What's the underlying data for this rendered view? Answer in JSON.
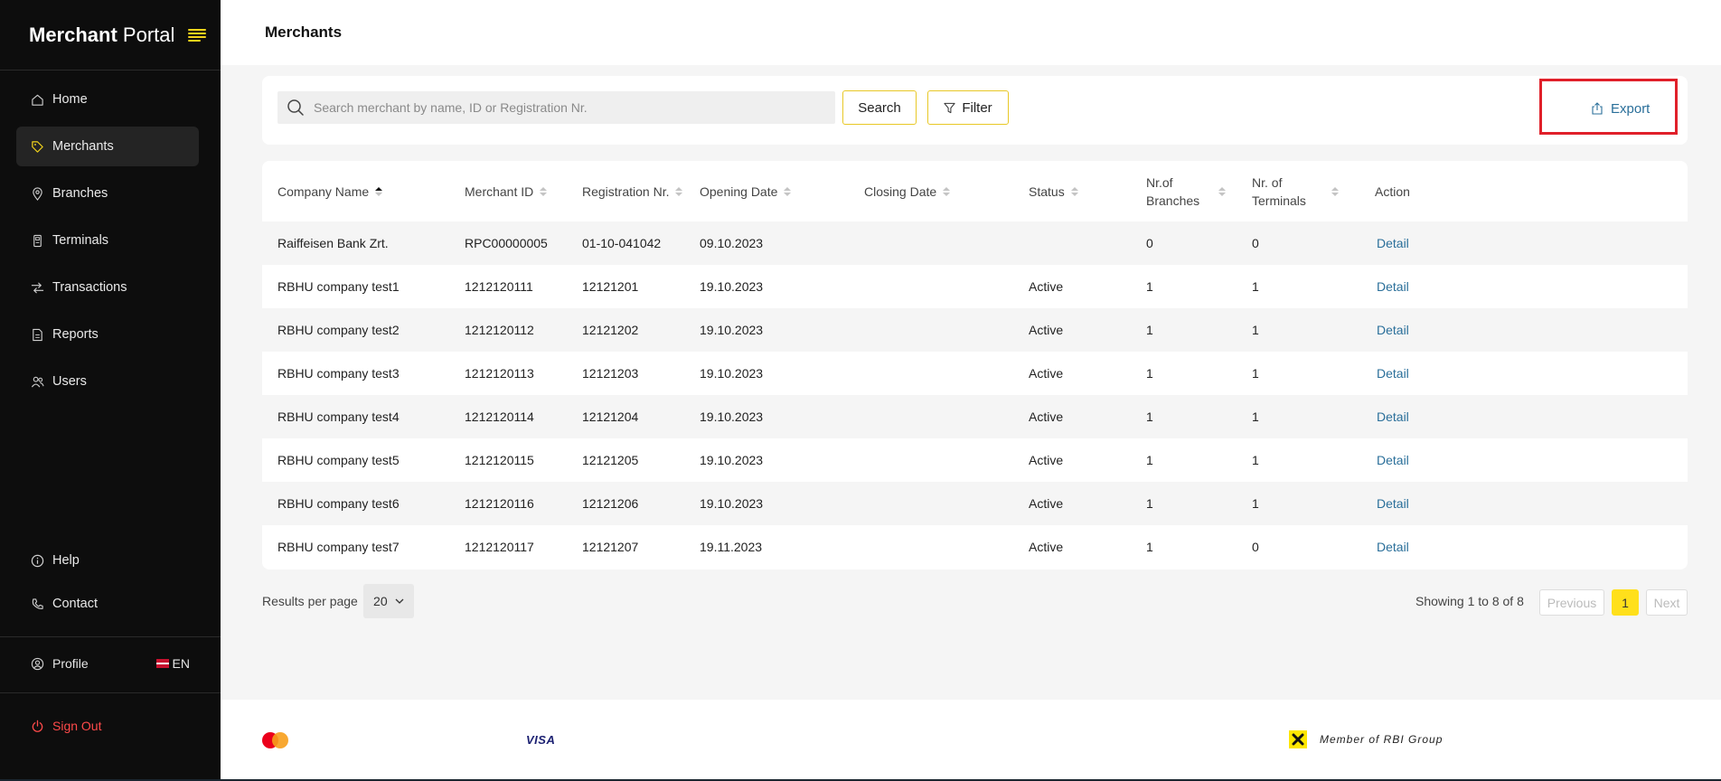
{
  "app": {
    "brand_bold": "Merchant",
    "brand_regular": "Portal"
  },
  "sidebar": {
    "items": [
      {
        "label": "Home",
        "icon": "home-icon"
      },
      {
        "label": "Merchants",
        "icon": "tag-icon",
        "active": true
      },
      {
        "label": "Branches",
        "icon": "location-pin-icon"
      },
      {
        "label": "Terminals",
        "icon": "terminal-icon"
      },
      {
        "label": "Transactions",
        "icon": "transfer-arrows-icon"
      },
      {
        "label": "Reports",
        "icon": "report-icon"
      },
      {
        "label": "Users",
        "icon": "users-icon"
      }
    ],
    "help_label": "Help",
    "contact_label": "Contact",
    "profile_label": "Profile",
    "language": "EN",
    "signout_label": "Sign Out"
  },
  "header": {
    "title": "Merchants"
  },
  "search": {
    "placeholder": "Search merchant by name, ID or Registration Nr.",
    "value": "",
    "search_label": "Search",
    "filter_label": "Filter",
    "export_label": "Export"
  },
  "table": {
    "columns": [
      "Company Name",
      "Merchant ID",
      "Registration Nr.",
      "Opening Date",
      "Closing Date",
      "Status",
      "Nr.of Branches",
      "Nr. of Terminals",
      "Action"
    ],
    "rows": [
      {
        "company": "Raiffeisen Bank Zrt.",
        "merchant_id": "RPC00000005",
        "registration": "01-10-041042",
        "opening": "09.10.2023",
        "closing": "",
        "status": "",
        "branches": "0",
        "terminals": "0",
        "action": "Detail"
      },
      {
        "company": "RBHU company test1",
        "merchant_id": "1212120111",
        "registration": "12121201",
        "opening": "19.10.2023",
        "closing": "",
        "status": "Active",
        "branches": "1",
        "terminals": "1",
        "action": "Detail"
      },
      {
        "company": "RBHU company test2",
        "merchant_id": "1212120112",
        "registration": "12121202",
        "opening": "19.10.2023",
        "closing": "",
        "status": "Active",
        "branches": "1",
        "terminals": "1",
        "action": "Detail"
      },
      {
        "company": "RBHU company test3",
        "merchant_id": "1212120113",
        "registration": "12121203",
        "opening": "19.10.2023",
        "closing": "",
        "status": "Active",
        "branches": "1",
        "terminals": "1",
        "action": "Detail"
      },
      {
        "company": "RBHU company test4",
        "merchant_id": "1212120114",
        "registration": "12121204",
        "opening": "19.10.2023",
        "closing": "",
        "status": "Active",
        "branches": "1",
        "terminals": "1",
        "action": "Detail"
      },
      {
        "company": "RBHU company test5",
        "merchant_id": "1212120115",
        "registration": "12121205",
        "opening": "19.10.2023",
        "closing": "",
        "status": "Active",
        "branches": "1",
        "terminals": "1",
        "action": "Detail"
      },
      {
        "company": "RBHU company test6",
        "merchant_id": "1212120116",
        "registration": "12121206",
        "opening": "19.10.2023",
        "closing": "",
        "status": "Active",
        "branches": "1",
        "terminals": "1",
        "action": "Detail"
      },
      {
        "company": "RBHU company test7",
        "merchant_id": "1212120117",
        "registration": "12121207",
        "opening": "19.11.2023",
        "closing": "",
        "status": "Active",
        "branches": "1",
        "terminals": "0",
        "action": "Detail"
      }
    ]
  },
  "pagination": {
    "results_per_page_label": "Results per page",
    "results_per_page": "20",
    "showing": "Showing 1 to 8 of 8",
    "previous": "Previous",
    "current_page": "1",
    "next": "Next"
  },
  "footer": {
    "visa": "VISA",
    "rbi": "Member of RBI Group"
  },
  "colors": {
    "accent": "#ffe01b",
    "link": "#2a6f9a",
    "highlight": "#e0202a",
    "sidebar": "#0d0d0d",
    "signout": "#ff4a4a"
  }
}
